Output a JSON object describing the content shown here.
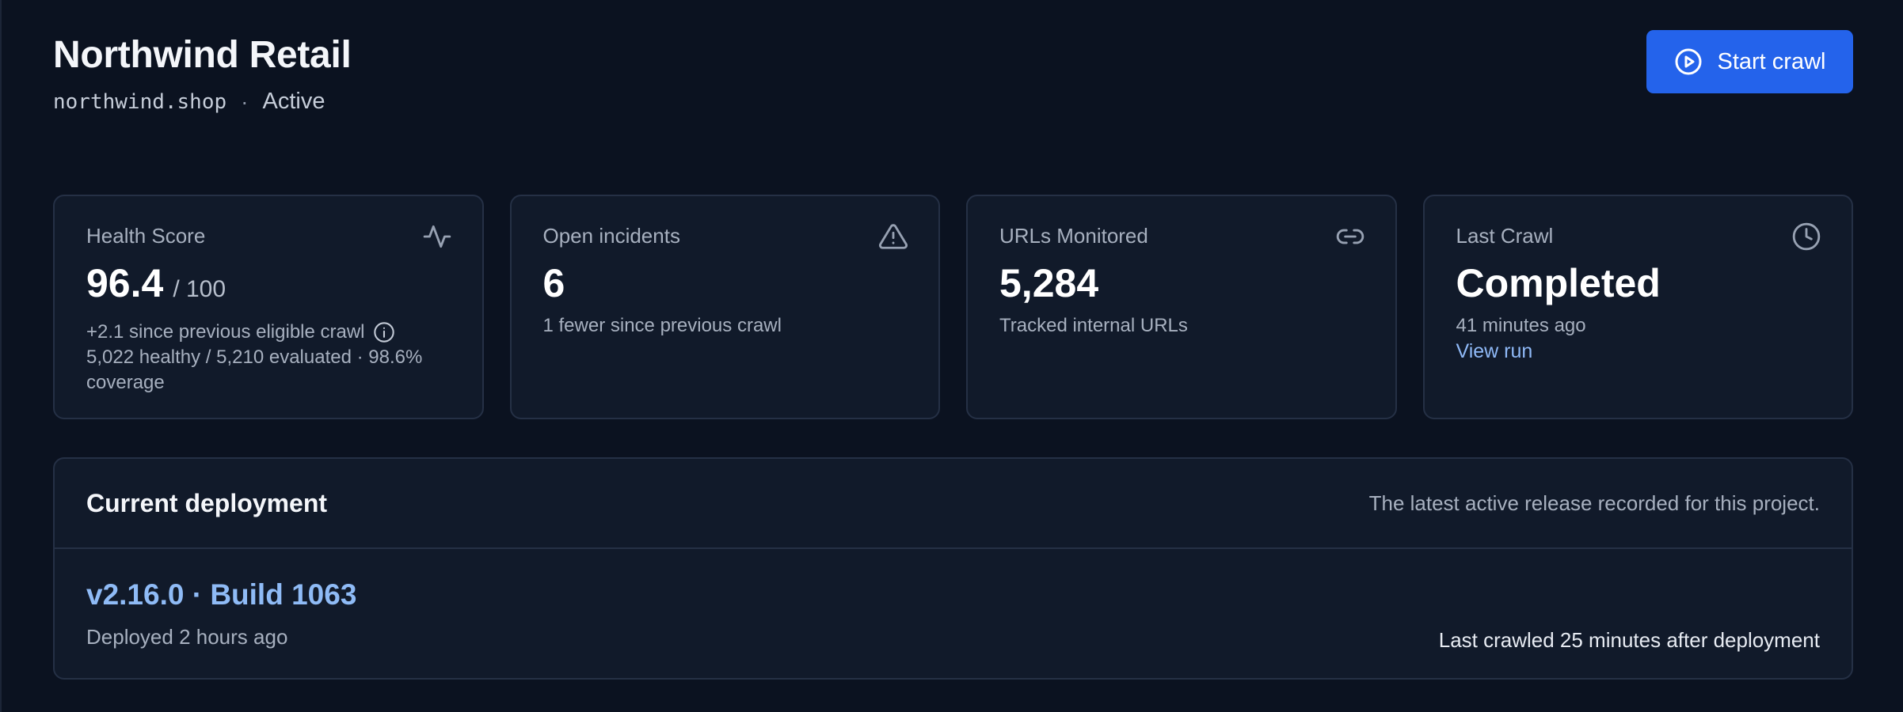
{
  "header": {
    "title": "Northwind Retail",
    "domain": "northwind.shop",
    "separator": "·",
    "status": "Active",
    "start_button": {
      "label": "Start crawl",
      "icon": "play-circle-icon"
    }
  },
  "cards": [
    {
      "label": "Health Score",
      "icon": "activity-icon",
      "value": "96.4",
      "unit": "/ 100",
      "note": "+2.1 since previous eligible crawl",
      "note_icon": "info-icon",
      "note2": "5,022 healthy / 5,210 evaluated · 98.6% coverage"
    },
    {
      "label": "Open incidents",
      "icon": "warning-triangle-icon",
      "value": "6",
      "note": "1 fewer since previous crawl"
    },
    {
      "label": "URLs Monitored",
      "icon": "link-icon",
      "value": "5,284",
      "note": "Tracked internal URLs"
    },
    {
      "label": "Last Crawl",
      "icon": "clock-icon",
      "value": "Completed",
      "note": "41 minutes ago",
      "link": "View run"
    }
  ],
  "deployment": {
    "title": "Current deployment",
    "description": "The latest active release recorded for this project.",
    "version": "v2.16.0 · Build 1063",
    "deployed": "Deployed 2 hours ago",
    "crawl_note": "Last crawled 25 minutes after deployment"
  },
  "colors": {
    "background": "#0b1220",
    "card": "#111a2a",
    "border": "#253045",
    "accent": "#2463eb",
    "link": "#8fb9f7"
  }
}
